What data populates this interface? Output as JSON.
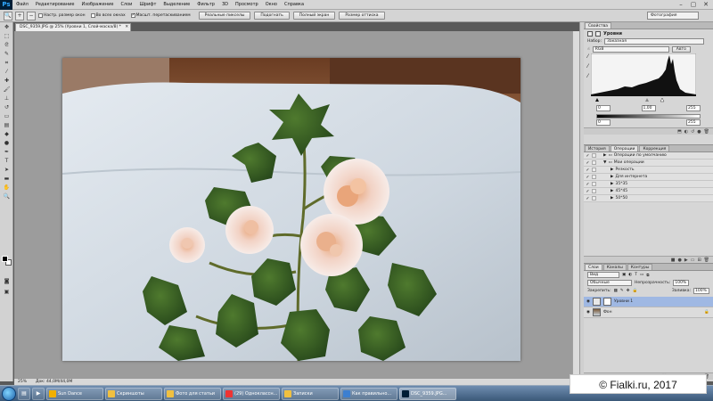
{
  "app": {
    "logo": "Ps",
    "menu": [
      "Файл",
      "Редактирование",
      "Изображение",
      "Слои",
      "Шрифт",
      "Выделение",
      "Фильтр",
      "3D",
      "Просмотр",
      "Окно",
      "Справка"
    ]
  },
  "options": {
    "checks": [
      {
        "label": "Настр. размер окон",
        "checked": false
      },
      {
        "label": "Во всех окнах",
        "checked": false
      },
      {
        "label": "Масшт. перетаскиванием",
        "checked": true
      }
    ],
    "buttons": [
      "Реальные пикселы",
      "Подогнать",
      "Полный экран",
      "Размер оттиска"
    ],
    "workspace": "Фотография"
  },
  "document": {
    "tab_title": "DSC_9359.JPG @ 25% (Уровни 1, Слой-маска/8) *",
    "zoom": "25%",
    "doc_info": "Док: 44,0M/44,0M"
  },
  "properties": {
    "tab": "Свойства",
    "title": "Уровни",
    "preset_label": "Набор:",
    "preset_value": "Заказная",
    "channel": "RGB",
    "auto_label": "Авто",
    "input_black": "0",
    "input_gamma": "1,00",
    "input_white": "255",
    "output_black": "0",
    "output_white": "255"
  },
  "actions": {
    "tabs": [
      "История",
      "Операции",
      "Коррекция"
    ],
    "rows": [
      {
        "label": "Операции по умолчанию",
        "indent": 0,
        "kind": "folder"
      },
      {
        "label": "Мои операции",
        "indent": 0,
        "kind": "folder-open"
      },
      {
        "label": "Резкость",
        "indent": 1,
        "kind": "action"
      },
      {
        "label": "Для интернета",
        "indent": 1,
        "kind": "action"
      },
      {
        "label": "35*35",
        "indent": 1,
        "kind": "action"
      },
      {
        "label": "45*45",
        "indent": 1,
        "kind": "action"
      },
      {
        "label": "50*50",
        "indent": 1,
        "kind": "action"
      }
    ]
  },
  "layers": {
    "tabs": [
      "Слои",
      "Каналы",
      "Контуры"
    ],
    "filter": "Вид",
    "blend_mode": "Обычные",
    "opacity_label": "Непрозрачность:",
    "opacity": "100%",
    "lock_label": "Закрепить:",
    "fill_label": "Заливка:",
    "fill": "100%",
    "items": [
      {
        "name": "Уровни 1",
        "selected": true
      },
      {
        "name": "Фон",
        "selected": false
      }
    ]
  },
  "taskbar": {
    "items": [
      {
        "label": "Sun Dance",
        "color": "#f0b000"
      },
      {
        "label": "Скриншоты",
        "color": "#f0c040"
      },
      {
        "label": "Фото для статьи",
        "color": "#f0c040"
      },
      {
        "label": "(29) Одноклассн...",
        "color": "#e33"
      },
      {
        "label": "Записки",
        "color": "#f0c040"
      },
      {
        "label": "Как правильно...",
        "color": "#3d7fd0"
      },
      {
        "label": "DSC_9359.JPG...",
        "color": "#001e36"
      }
    ]
  },
  "watermark": "© Fialki.ru, 2017"
}
